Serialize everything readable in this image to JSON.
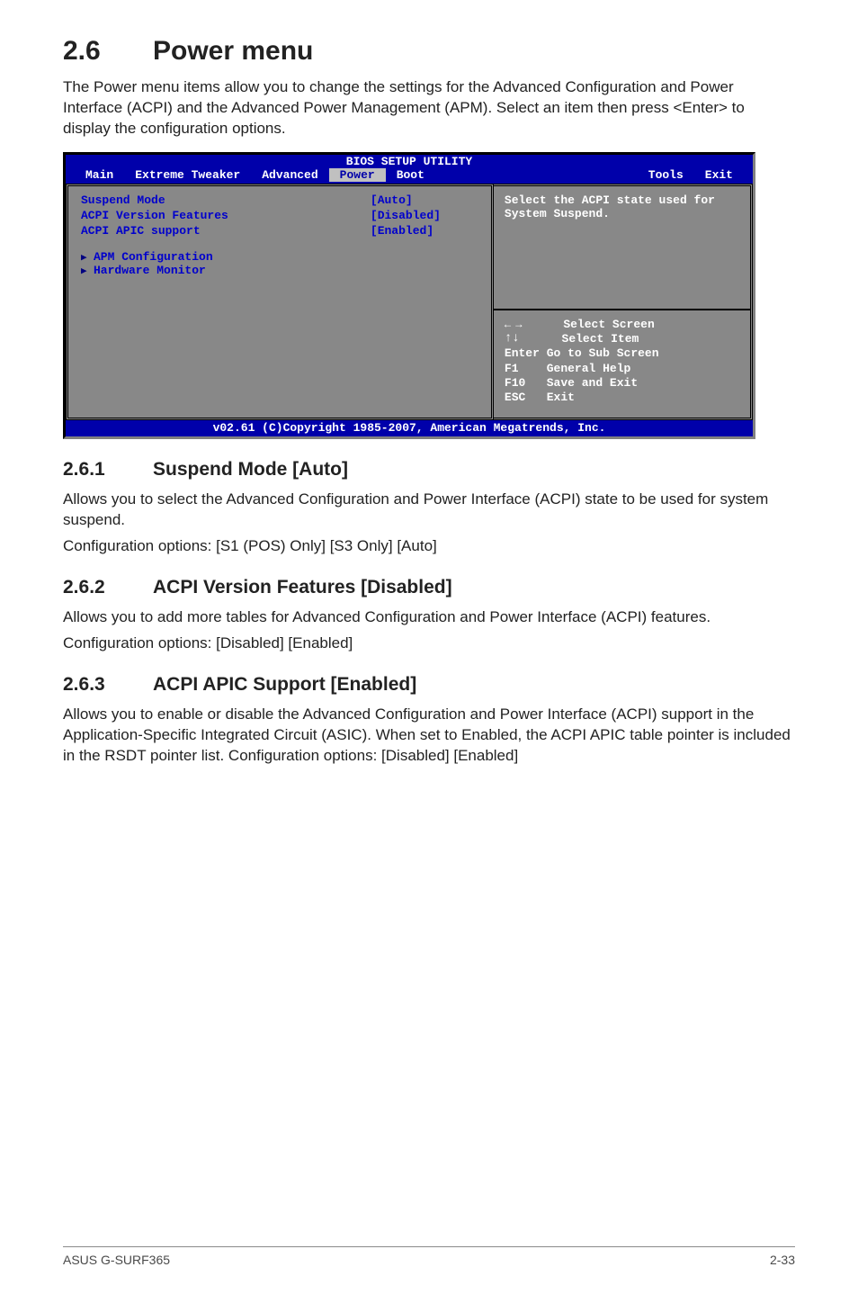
{
  "heading": {
    "num": "2.6",
    "title": "Power menu"
  },
  "intro": "The Power menu items allow you to change the settings for the Advanced Configuration and Power Interface (ACPI) and the Advanced Power Management (APM). Select an item then press <Enter> to display the configuration options.",
  "bios": {
    "title": "BIOS SETUP UTILITY",
    "tabs": [
      "Main",
      "Extreme Tweaker",
      "Advanced",
      "Power",
      "Boot",
      "Tools",
      "Exit"
    ],
    "items": [
      {
        "label": "Suspend Mode",
        "value": "[Auto]"
      },
      {
        "label": "ACPI Version Features",
        "value": "[Disabled]"
      },
      {
        "label": "ACPI APIC support",
        "value": "[Enabled]"
      }
    ],
    "subs": [
      "APM Configuration",
      "Hardware Monitor"
    ],
    "help": "Select the ACPI state used for System Suspend.",
    "keys": {
      "l0": "      Select Screen",
      "l1": "      Select Item",
      "l2": "Enter Go to Sub Screen",
      "l3": "F1    General Help",
      "l4": "F10   Save and Exit",
      "l5": "ESC   Exit"
    },
    "footer": "v02.61 (C)Copyright 1985-2007, American Megatrends, Inc."
  },
  "sections": [
    {
      "num": "2.6.1",
      "title": "Suspend Mode [Auto]",
      "p1": "Allows you to select the Advanced Configuration and Power Interface (ACPI) state to be used for system suspend.",
      "p2": "Configuration options: [S1 (POS) Only] [S3 Only] [Auto]"
    },
    {
      "num": "2.6.2",
      "title": "ACPI Version Features [Disabled]",
      "p1": "Allows you to add more tables for Advanced Configuration and Power Interface (ACPI) features.",
      "p2": "Configuration options: [Disabled] [Enabled]"
    },
    {
      "num": "2.6.3",
      "title": "ACPI APIC Support [Enabled]",
      "p1": "Allows you to enable or disable the Advanced Configuration and Power Interface (ACPI) support in the Application-Specific Integrated Circuit (ASIC). When set to Enabled, the ACPI APIC table pointer is included in the RSDT pointer list. Configuration options: [Disabled] [Enabled]",
      "p2": ""
    }
  ],
  "footer": {
    "left": "ASUS G-SURF365",
    "right": "2-33"
  }
}
